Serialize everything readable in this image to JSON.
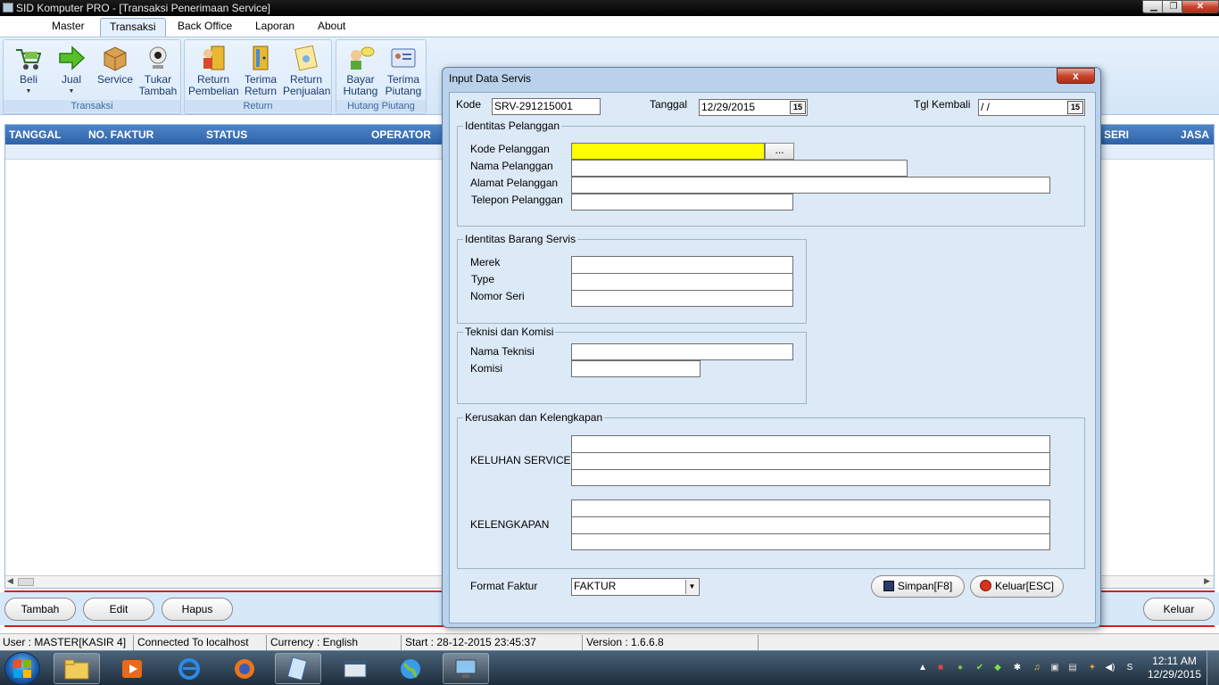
{
  "window": {
    "title": "SID Komputer PRO - [Transaksi Penerimaan Service]"
  },
  "menu": [
    "Master",
    "Transaksi",
    "Back Office",
    "Laporan",
    "About"
  ],
  "ribbon": {
    "groups": [
      {
        "label": "Transaksi",
        "buttons": [
          {
            "line1": "Beli",
            "line2": ""
          },
          {
            "line1": "Jual",
            "line2": ""
          },
          {
            "line1": "Service",
            "line2": ""
          },
          {
            "line1": "Tukar",
            "line2": "Tambah"
          }
        ]
      },
      {
        "label": "Return",
        "buttons": [
          {
            "line1": "Return",
            "line2": "Pembelian"
          },
          {
            "line1": "Terima",
            "line2": "Return"
          },
          {
            "line1": "Return",
            "line2": "Penjualan"
          }
        ]
      },
      {
        "label": "Hutang Piutang",
        "buttons": [
          {
            "line1": "Bayar",
            "line2": "Hutang"
          },
          {
            "line1": "Terima",
            "line2": "Piutang"
          }
        ]
      }
    ]
  },
  "grid": {
    "columns": [
      "TANGGAL",
      "NO. FAKTUR",
      "STATUS",
      "OPERATOR",
      "SERI",
      "JASA"
    ]
  },
  "bottom_buttons": {
    "tambah": "Tambah",
    "edit": "Edit",
    "hapus": "Hapus",
    "keluar": "Keluar"
  },
  "statusbar": {
    "user": "User : MASTER[KASIR 4]",
    "connection": "Connected To localhost",
    "currency": "Currency : English",
    "start": "Start  : 28-12-2015 23:45:37",
    "version": "Version : 1.6.6.8"
  },
  "dialog": {
    "title": "Input Data Servis",
    "close_label": "x",
    "kode_label": "Kode",
    "kode_value": "SRV-291215001",
    "tanggal_label": "Tanggal",
    "tanggal_value": "12/29/2015",
    "tgl_kembali_label": "Tgl Kembali",
    "tgl_kembali_value": " /  /",
    "calendar_label": "15",
    "pelanggan": {
      "title": "Identitas Pelanggan",
      "kode_label": "Kode Pelanggan",
      "kode_value": "",
      "lookup_label": "...",
      "nama_label": "Nama Pelanggan",
      "nama_value": "",
      "alamat_label": "Alamat Pelanggan",
      "alamat_value": "",
      "telepon_label": "Telepon Pelanggan",
      "telepon_value": ""
    },
    "barang": {
      "title": "Identitas Barang Servis",
      "merek_label": "Merek",
      "type_label": "Type",
      "seri_label": "Nomor Seri"
    },
    "teknisi": {
      "title": "Teknisi dan Komisi",
      "nama_label": "Nama Teknisi",
      "komisi_label": "Komisi"
    },
    "kerusakan": {
      "title": "Kerusakan dan Kelengkapan",
      "keluhan_label": "KELUHAN SERVICE",
      "kelengkapan_label": "KELENGKAPAN"
    },
    "format_label": "Format Faktur",
    "format_value": "FAKTUR",
    "simpan_label": "Simpan[F8]",
    "keluar_label": "Keluar[ESC]"
  },
  "taskbar": {
    "clock_time": "12:11 AM",
    "clock_date": "12/29/2015"
  }
}
